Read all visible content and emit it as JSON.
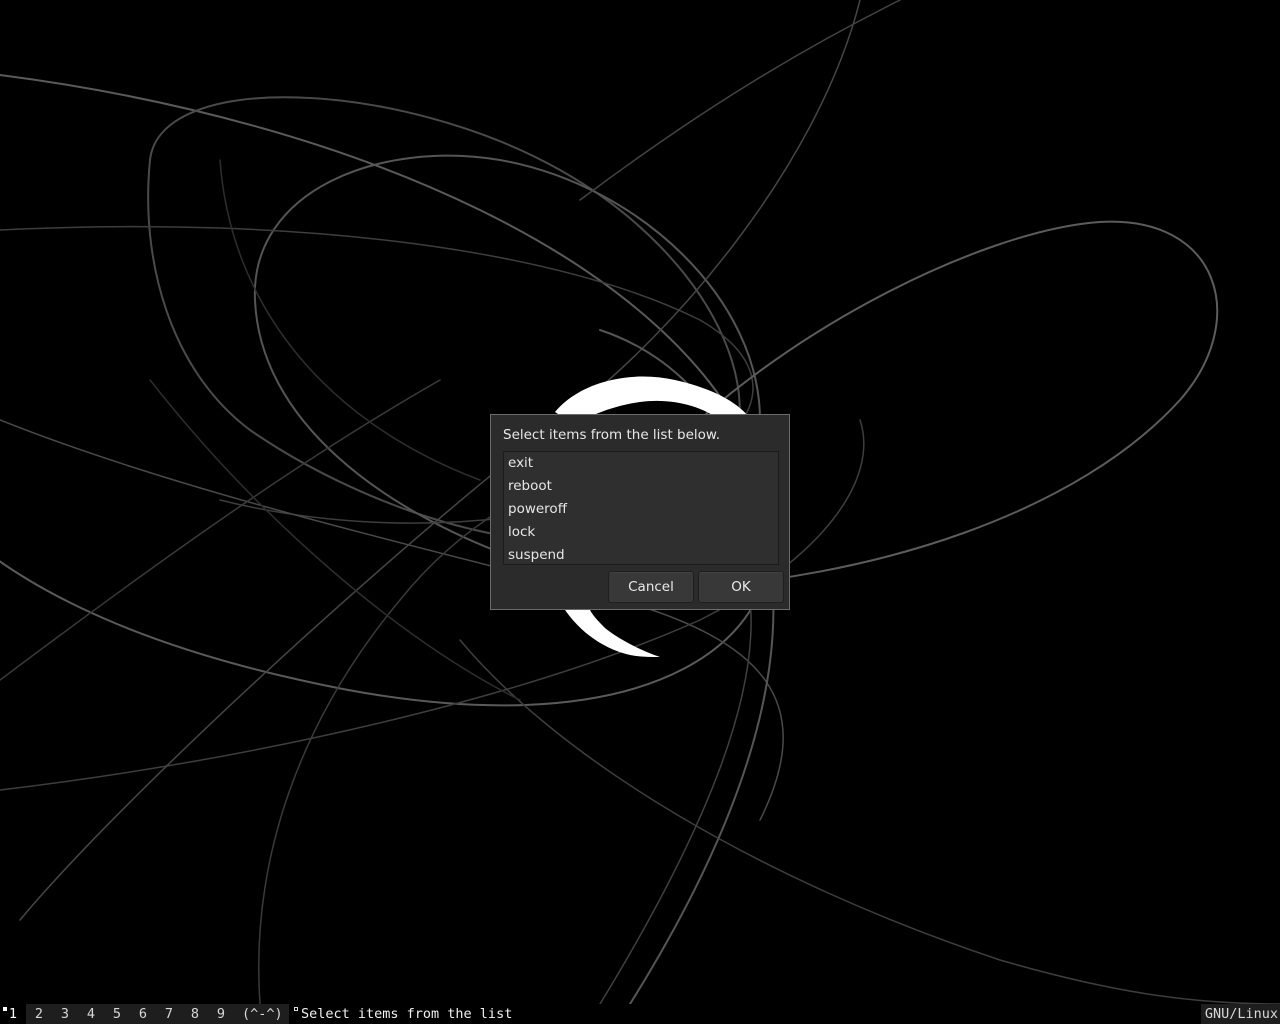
{
  "dialog": {
    "prompt": "Select items from the list below.",
    "items": [
      "exit",
      "reboot",
      "poweroff",
      "lock",
      "suspend"
    ],
    "cancel_label": "Cancel",
    "ok_label": "OK"
  },
  "statusbar": {
    "workspaces": [
      "1",
      "2",
      "3",
      "4",
      "5",
      "6",
      "7",
      "8",
      "9"
    ],
    "active_workspace": "1",
    "layout": "(^-^)",
    "window_title": "Select items from the list",
    "status": "GNU/Linux"
  },
  "colors": {
    "desktop_background": "#000000",
    "dialog_background": "#2b2b2b",
    "bar_segment": "#1e1e1e"
  }
}
